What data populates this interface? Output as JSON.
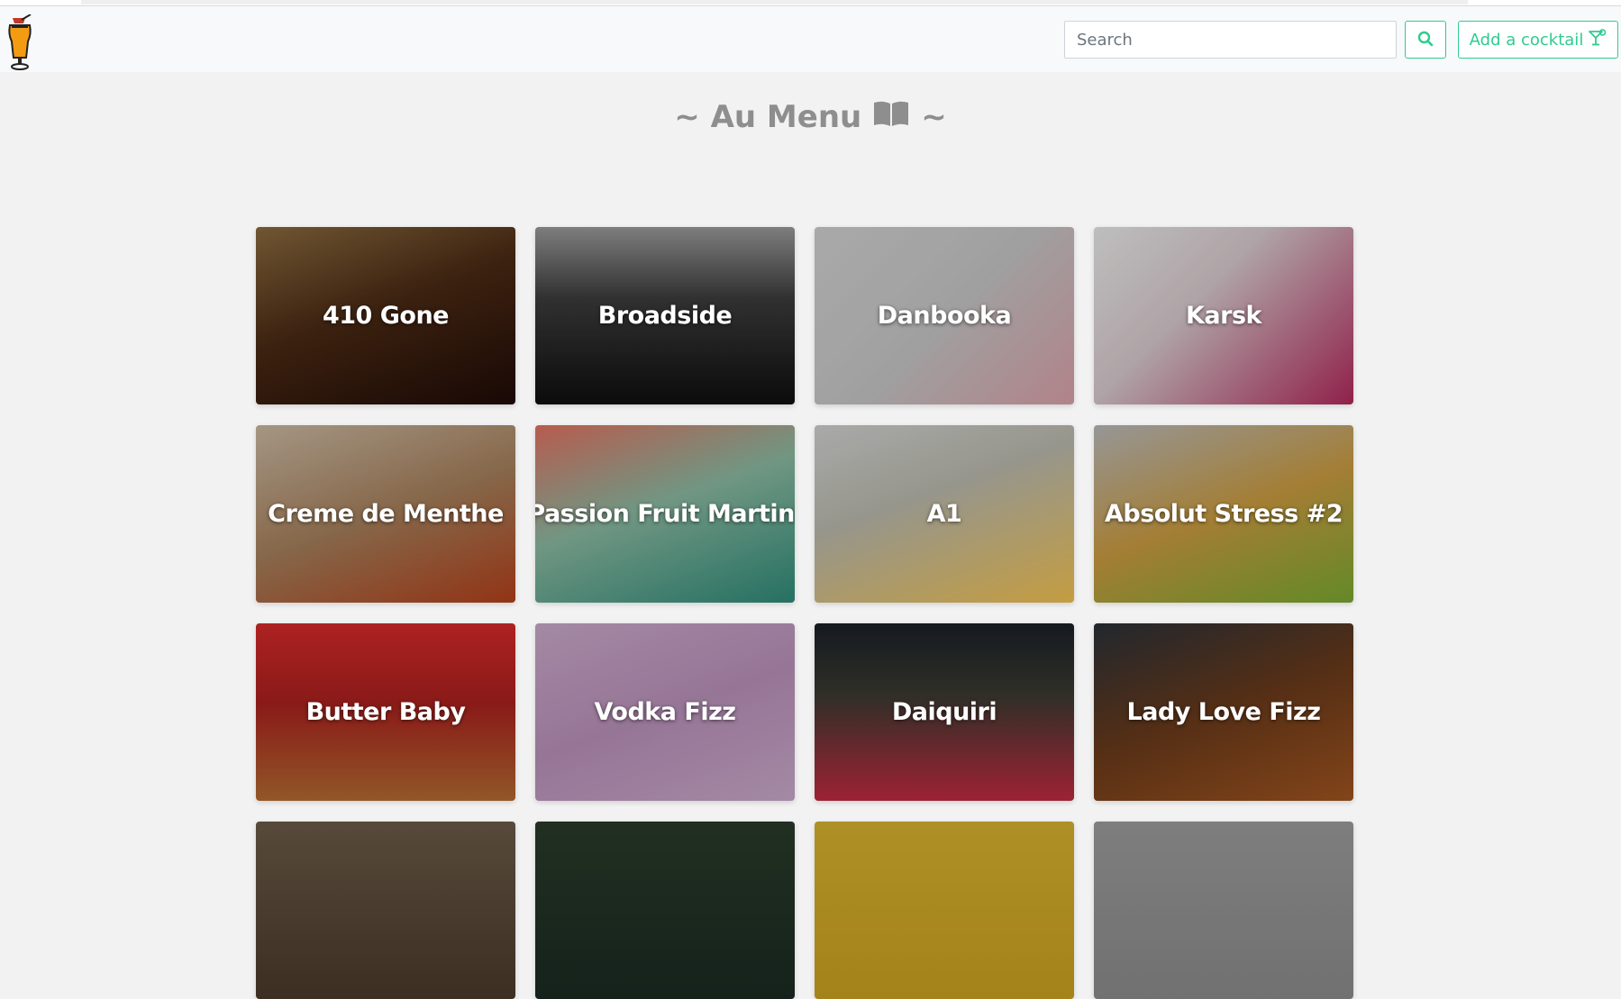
{
  "navbar": {
    "logo_icon": "cocktail-glass-icon",
    "search": {
      "placeholder": "Search",
      "value": ""
    },
    "search_button_icon": "search-icon",
    "add_button_label": "Add a cocktail",
    "add_button_icon": "cocktail-icon",
    "accent_color": "#2ecc8f"
  },
  "heading": {
    "prefix": "~ Au Menu",
    "icon": "book-icon",
    "suffix": "~"
  },
  "cocktails": [
    {
      "name": "410 Gone",
      "bg": "linear-gradient(160deg,#8a6a3e 0%,#4a2a14 45%,#1e0a06 100%)"
    },
    {
      "name": "Broadside",
      "bg": "linear-gradient(180deg,#9a9a9a 0%,#3c3c3c 40%,#0e0e0e 100%)"
    },
    {
      "name": "Danbooka",
      "bg": "linear-gradient(135deg,#cfcfcf 0%,#c4c4c4 50%,#d8a0a8 100%)"
    },
    {
      "name": "Karsk",
      "bg": "linear-gradient(135deg,#e8e8e8 0%,#d6c8cc 40%,#b0285a 100%)"
    },
    {
      "name": "Creme de Menthe",
      "bg": "linear-gradient(160deg,#c9b8a2 0%,#a47e5a 50%,#b2401a 100%)"
    },
    {
      "name": "Passion Fruit Martini",
      "bg": "linear-gradient(160deg,#e07060 0%,#8ab8a0 45%,#2e8a78 100%)"
    },
    {
      "name": "A1",
      "bg": "linear-gradient(160deg,#cfcfcf 0%,#b8b8ac 40%,#f0c050 100%)"
    },
    {
      "name": "Absolut Stress #2",
      "bg": "linear-gradient(160deg,#b8b8b8 0%,#c89a40 50%,#7aa830 100%)"
    },
    {
      "name": "Butter Baby",
      "bg": "linear-gradient(180deg,#d42a2a 0%,#a8201e 45%,#b26a30 100%)"
    },
    {
      "name": "Vodka Fizz",
      "bg": "linear-gradient(160deg,#c8a8c8 0%,#b890b8 50%,#c8a8c8 100%)"
    },
    {
      "name": "Daiquiri",
      "bg": "linear-gradient(180deg,#1a2028 0%,#3a3a30 40%,#c02a40 100%)"
    },
    {
      "name": "Lady Love Fizz",
      "bg": "linear-gradient(160deg,#2a3038 0%,#6a3a1a 50%,#a05420 100%)"
    },
    {
      "name": "",
      "bg": "linear-gradient(180deg,#6a5a48 0%,#4a3a2a 100%)"
    },
    {
      "name": "",
      "bg": "linear-gradient(180deg,#2a3a2a 0%,#1a2a22 100%)"
    },
    {
      "name": "",
      "bg": "linear-gradient(180deg,#d4b030 0%,#c8a020 100%)"
    },
    {
      "name": "",
      "bg": "linear-gradient(180deg,#9a9a9a 0%,#8a8a8a 100%)"
    }
  ]
}
